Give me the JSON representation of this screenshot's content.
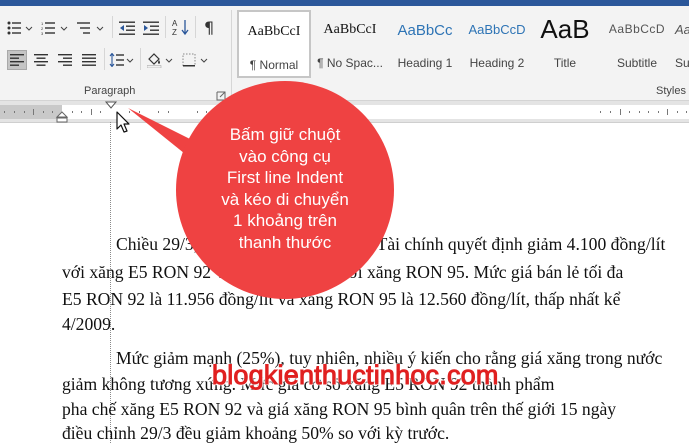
{
  "ribbon": {
    "paragraph_group_label": "Paragraph",
    "styles_group_label": "Styles",
    "styles": [
      {
        "preview": "AaBbCcI",
        "name": "¶ Normal"
      },
      {
        "preview": "AaBbCcI",
        "name": "¶ No Spac..."
      },
      {
        "preview": "AaBbCc",
        "name": "Heading 1"
      },
      {
        "preview": "AaBbCcD",
        "name": "Heading 2"
      },
      {
        "preview": "AaB",
        "name": "Title"
      },
      {
        "preview": "AaBbCcD",
        "name": "Subtitle"
      },
      {
        "preview": "AaBbC",
        "name": "Su"
      }
    ],
    "active_style": "¶ Normal",
    "accent_color": "#2b579a"
  },
  "callout": {
    "lines": [
      "Bấm giữ chuột",
      "vào công cụ",
      "First line Indent",
      "và kéo di chuyển",
      "1 khoảng trên",
      "thanh thước"
    ],
    "color": "#ef4242"
  },
  "document": {
    "lines": [
      "Chiều 29/3, Liên Bộ Công Thương - Tài chính quyết định giảm 4.100 đồng/lít",
      "với xăng E5 RON 92 và 4.000 đồng/lít với xăng RON 95. Mức giá bán lẻ tối đa",
      "E5 RON 92 là 11.956 đồng/lít và xăng RON 95 là 12.560 đồng/lít, thấp nhất kể",
      "4/2009.",
      "Mức giảm mạnh (25%), tuy nhiên, nhiều ý kiến cho rằng giá xăng trong nước",
      "giảm không tương xứng. Mức giá cơ sở xăng E5 RON 92 thành phẩm",
      "pha chế xăng E5 RON 92 và giá xăng RON 95 bình quân trên thế giới 15 ngày",
      "điều chỉnh 29/3 đều giảm khoảng 50% so với kỳ trước."
    ]
  },
  "watermark": {
    "text": "blogkienthuctinhoc.com",
    "color": "#e02020"
  }
}
